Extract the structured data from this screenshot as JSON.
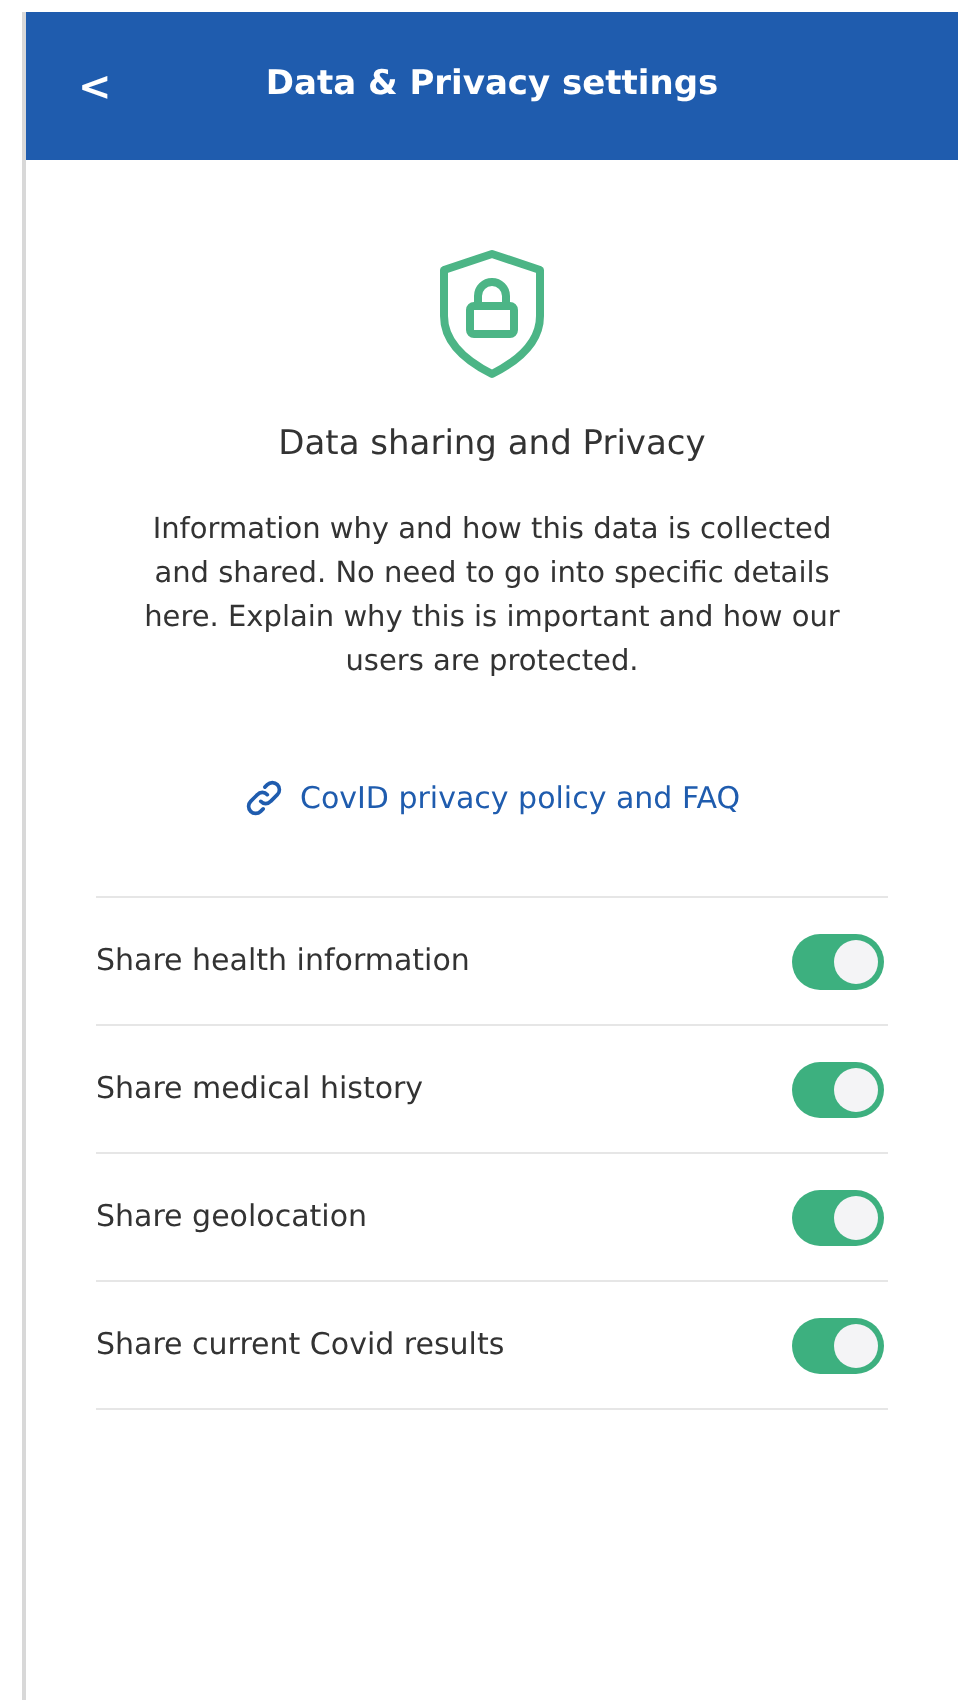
{
  "header": {
    "back": "<",
    "title": "Data & Privacy settings"
  },
  "intro": {
    "title": "Data sharing and Privacy",
    "text": "Information why and how this data is collected and shared. No need to go into specific details here. Explain why this is important and how our users are protected."
  },
  "link": "CovID privacy policy and FAQ",
  "settings": [
    {
      "label": "Share health information",
      "on": true
    },
    {
      "label": "Share medical history",
      "on": true
    },
    {
      "label": "Share geolocation",
      "on": true
    },
    {
      "label": "Share current Covid results",
      "on": true
    }
  ]
}
